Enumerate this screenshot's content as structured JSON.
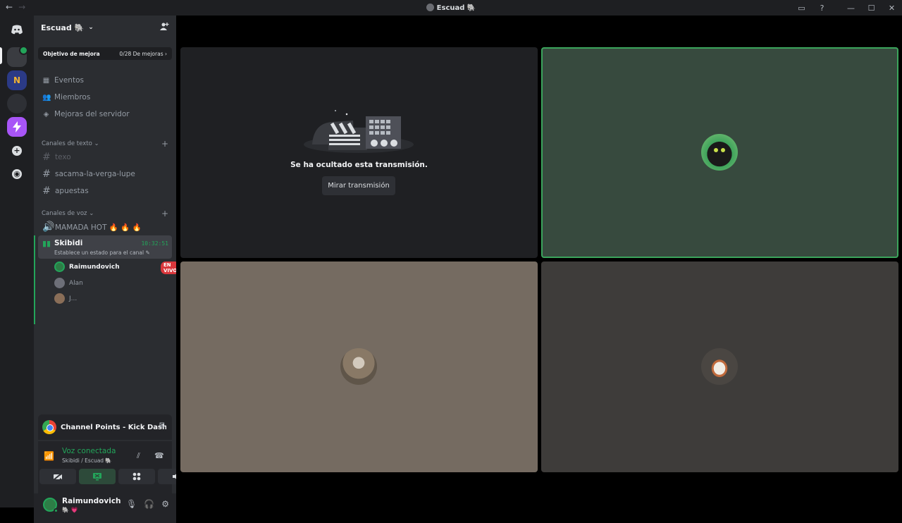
{
  "titlebar": {
    "title": "Escuad 🐘",
    "back_label": "←",
    "forward_label": "→"
  },
  "window_controls": {
    "inbox": "▭",
    "help": "?",
    "minimize": "—",
    "maximize": "☐",
    "close": "✕"
  },
  "rail": {
    "icons": [
      "discord-icon",
      "server-1",
      "server-2",
      "server-3",
      "server-4",
      "add-server-icon",
      "discover-icon"
    ],
    "server2_text": "N",
    "add_text": "+",
    "discover_text": "◉"
  },
  "server": {
    "name": "Escuad 🐘",
    "chevron": "⌄"
  },
  "boost": {
    "label": "Objetivo de mejora",
    "progress": "0/28 De mejoras",
    "chev": "›"
  },
  "nav": {
    "events": "Eventos",
    "members": "Miembros",
    "boosts": "Mejoras del servidor"
  },
  "text_category": "Canales de texto",
  "text_channels": [
    "texo",
    "sacama-la-verga-lupe",
    "apuestas"
  ],
  "voice_category": "Canales de voz",
  "voice_channels": {
    "first": "MAMADA HOT 🔥 🔥 🔥",
    "active": "Skibidi",
    "timer": "10:32:51",
    "status": "Establece un estado para el canal ✎"
  },
  "voice_users": [
    {
      "name": "Raimundovich",
      "live": "EN VIVO"
    },
    {
      "name": "Alan"
    },
    {
      "name": "J..."
    }
  ],
  "activity": {
    "title": "Channel Points - Kick Dashboard - ..."
  },
  "voice_panel": {
    "status": "Voz conectada",
    "location": "Skibidi / Escuad 🐘"
  },
  "user": {
    "name": "Raimundovich",
    "status": "🐘 💗"
  },
  "stage": {
    "hidden_message": "Se ha ocultado esta transmisión.",
    "watch_button": "Mirar transmisión"
  },
  "colors": {
    "accent_green": "#23a55a",
    "live_red": "#da373c",
    "bg_sidebar": "#2b2d31",
    "bg_rail": "#1e1f22"
  }
}
